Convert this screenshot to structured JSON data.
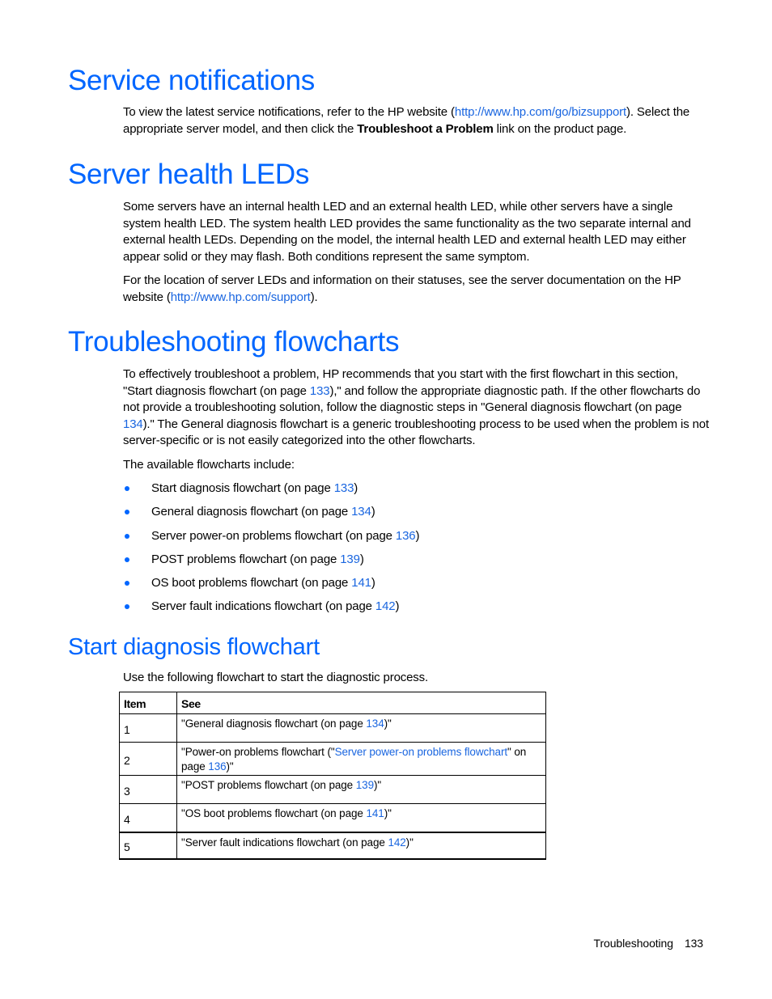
{
  "sections": {
    "service": {
      "title": "Service notifications",
      "p1_a": "To view the latest service notifications, refer to the HP website (",
      "p1_link": "http://www.hp.com/go/bizsupport",
      "p1_b": "). Select the appropriate server model, and then click the ",
      "p1_bold": "Troubleshoot a Problem",
      "p1_c": " link on the product page."
    },
    "leds": {
      "title": "Server health LEDs",
      "p1": "Some servers have an internal health LED and an external health LED, while other servers have a single system health LED. The system health LED provides the same functionality as the two separate internal and external health LEDs. Depending on the model, the internal health LED and external health LED may either appear solid or they may flash. Both conditions represent the same symptom.",
      "p2_a": "For the location of server LEDs and information on their statuses, see the server documentation on the HP website (",
      "p2_link": "http://www.hp.com/support",
      "p2_b": ")."
    },
    "flowcharts": {
      "title": "Troubleshooting flowcharts",
      "p1_a": "To effectively troubleshoot a problem, HP recommends that you start with the first flowchart in this section, \"Start diagnosis flowchart (on page ",
      "p1_link1": "133",
      "p1_b": "),\" and follow the appropriate diagnostic path. If the other flowcharts do not provide a troubleshooting solution, follow the diagnostic steps in \"General diagnosis flowchart (on page ",
      "p1_link2": "134",
      "p1_c": ").\" The General diagnosis flowchart is a generic troubleshooting process to be used when the problem is not server-specific or is not easily categorized into the other flowcharts.",
      "p2": "The available flowcharts include:",
      "items": [
        {
          "text": "Start diagnosis flowchart (on page ",
          "page": "133",
          "close": ")"
        },
        {
          "text": "General diagnosis flowchart (on page ",
          "page": "134",
          "close": ")"
        },
        {
          "text": "Server power-on problems flowchart (on page ",
          "page": "136",
          "close": ")"
        },
        {
          "text": "POST problems flowchart (on page ",
          "page": "139",
          "close": ")"
        },
        {
          "text": "OS boot problems flowchart (on page ",
          "page": "141",
          "close": ")"
        },
        {
          "text": "Server fault indications flowchart (on page ",
          "page": "142",
          "close": ")"
        }
      ]
    },
    "start": {
      "title": "Start diagnosis flowchart",
      "p1": "Use the following flowchart to start the diagnostic process.",
      "table": {
        "headers": [
          "Item",
          "See"
        ],
        "rows": [
          {
            "item": "1",
            "pre": "\"General diagnosis flowchart (on page ",
            "link": "134",
            "post": ")\""
          },
          {
            "item": "2",
            "pre": "\"Power-on problems flowchart (\"",
            "link_text": "Server power-on problems flowchart",
            "mid": "\" on page ",
            "link": "136",
            "post": ")\""
          },
          {
            "item": "3",
            "pre": "\"POST problems flowchart (on page ",
            "link": "139",
            "post": ")\""
          },
          {
            "item": "4",
            "pre": "\"OS boot problems flowchart (on page ",
            "link": "141",
            "post": ")\""
          },
          {
            "item": "5",
            "pre": "\"Server fault indications flowchart (on page ",
            "link": "142",
            "post": ")\""
          }
        ]
      }
    }
  },
  "footer": {
    "section": "Troubleshooting",
    "page": "133"
  },
  "colors": {
    "heading": "#0066ff",
    "link": "#1a66e0"
  }
}
